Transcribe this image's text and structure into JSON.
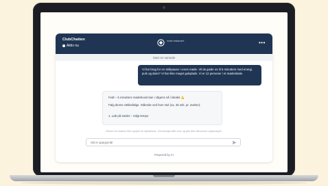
{
  "chat": {
    "bot_name": "ClubChatten",
    "status": "Aktiv nu",
    "brand_text": "norsk restaurant",
    "menu_icon": "more-horizontal-icon",
    "status_chip": "Start en samtale",
    "user_message": "Vi har brug for en strikpause i vores møde. Vil du guide os til 5 minutters med energi, puls og dans? Vi har ikke meget gulvplads. Vi er 12 personer i et mødelokale.",
    "bot_reply": {
      "line1": "Fedt – 5 minutters mødeboost kan i vågens nå i lokalet 💪",
      "line2": "Følg denne rækkefølge. Stående ved hver stol (ca. 45 sek. pr. øvelse):",
      "line3": "1. Løb på stedet – roligt tempo"
    },
    "disclaimer": "Denne AI-chatbot blev hjulpet af vejledende. Gennemgå altid svar og tjek ikke følsomme oplysninger.",
    "input_placeholder": "Stil et spørgsmål",
    "send_icon": "send-icon",
    "powered_by": "Powered by AI",
    "colors": {
      "header": "#1f3553",
      "user_bubble": "#1f3553",
      "background": "#fbf3dd"
    }
  }
}
